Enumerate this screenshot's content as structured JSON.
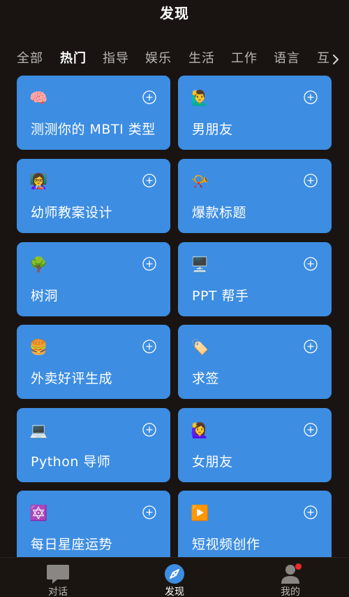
{
  "header": {
    "title": "发现"
  },
  "tabs": [
    {
      "label": "全部",
      "active": false
    },
    {
      "label": "热门",
      "active": true
    },
    {
      "label": "指导",
      "active": false
    },
    {
      "label": "娱乐",
      "active": false
    },
    {
      "label": "生活",
      "active": false
    },
    {
      "label": "工作",
      "active": false
    },
    {
      "label": "语言",
      "active": false
    }
  ],
  "tab_overflow": {
    "partial_label": "互"
  },
  "cards": [
    {
      "emoji": "🧠",
      "icon": "brain-icon",
      "label": "测测你的 MBTI 类型"
    },
    {
      "emoji": "🙋‍♂️",
      "icon": "man-raising-hand-icon",
      "label": "男朋友"
    },
    {
      "emoji": "👩‍🏫",
      "icon": "teacher-icon",
      "label": "幼师教案设计"
    },
    {
      "emoji": "📯",
      "icon": "postal-horn-icon",
      "label": "爆款标题"
    },
    {
      "emoji": "🌳",
      "icon": "tree-icon",
      "label": "树洞"
    },
    {
      "emoji": "🖥️",
      "icon": "desktop-computer-icon",
      "label": "PPT 帮手"
    },
    {
      "emoji": "🍔",
      "icon": "hamburger-icon",
      "label": "外卖好评生成"
    },
    {
      "emoji": "🏷️",
      "icon": "label-tag-icon",
      "label": "求签"
    },
    {
      "emoji": "💻",
      "icon": "laptop-icon",
      "label": "Python 导师"
    },
    {
      "emoji": "🙋‍♀️",
      "icon": "woman-raising-hand-icon",
      "label": "女朋友"
    },
    {
      "emoji": "🔯",
      "icon": "six-pointed-star-icon",
      "label": "每日星座运势"
    },
    {
      "emoji": "▶️",
      "icon": "play-button-icon",
      "label": "短视频创作"
    }
  ],
  "bottom_nav": [
    {
      "label": "对话",
      "icon": "chat-bubble-icon",
      "active": false
    },
    {
      "label": "发现",
      "icon": "compass-icon",
      "active": true
    },
    {
      "label": "我的",
      "icon": "person-icon",
      "active": false,
      "badge": true
    }
  ],
  "colors": {
    "background": "#191411",
    "card": "#3d8de2",
    "inactive_text": "#b9b6b2",
    "active_text": "#ffffff",
    "badge": "#ee2a2a"
  }
}
